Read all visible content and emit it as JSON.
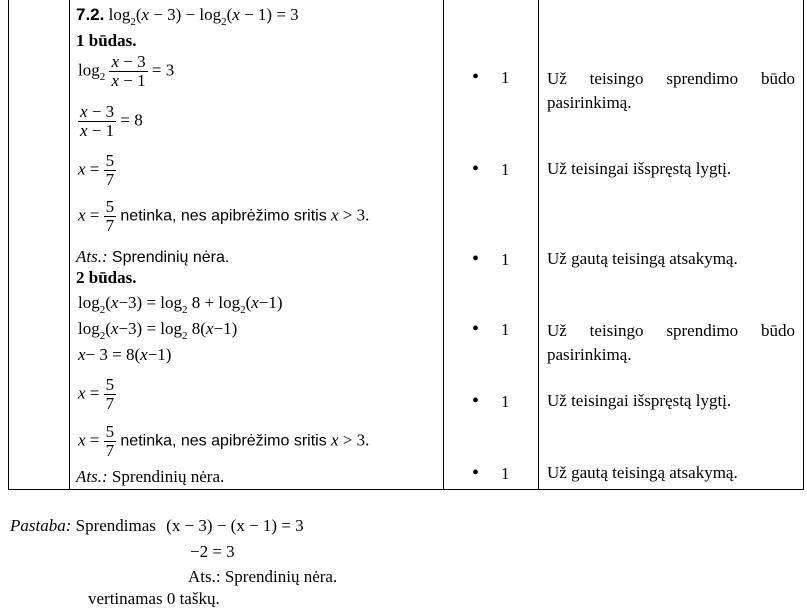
{
  "problem": {
    "number": "7.2.",
    "equation": "log2(x − 3) − log2(x − 1) = 3"
  },
  "method1": {
    "title": "1 būdas.",
    "lines": [
      "log2 (x − 3)/(x − 1) = 3",
      "(x − 3)/(x − 1) = 8",
      "x = 5/7",
      "x = 5/7 netinka, nes apibrėžimo sritis x > 3."
    ],
    "not_fit_text": "netinka, nes apibrėžimo sritis",
    "answer_label": "Ats.:",
    "answer_text": "Sprendinių nėra."
  },
  "method2": {
    "title": "2 būdas.",
    "not_fit_text": "netinka, nes apibrėžimo sritis",
    "answer_label": "Ats.:",
    "answer_text": "Sprendinių nėra."
  },
  "scores": [
    {
      "bullet": "•",
      "points": "1",
      "criterion": "Už teisingo sprendimo būdo pasirinkimą."
    },
    {
      "bullet": "•",
      "points": "1",
      "criterion": "Už teisingai išspręstą lygtį."
    },
    {
      "bullet": "•",
      "points": "1",
      "criterion": "Už gautą teisingą atsakymą."
    },
    {
      "bullet": "•",
      "points": "1",
      "criterion": "Už teisingo sprendimo būdo pasirinkimą."
    },
    {
      "bullet": "•",
      "points": "1",
      "criterion": "Už teisingai išspręstą lygtį."
    },
    {
      "bullet": "•",
      "points": "1",
      "criterion": "Už gautą teisingą atsakymą."
    }
  ],
  "note": {
    "label": "Pastaba:",
    "text": "Sprendimas",
    "line1": "(x − 3) − (x − 1) = 3",
    "line2": "−2 = 3",
    "line3": "Ats.: Sprendinių nėra.",
    "line4": "vertinamas 0 taškų."
  }
}
